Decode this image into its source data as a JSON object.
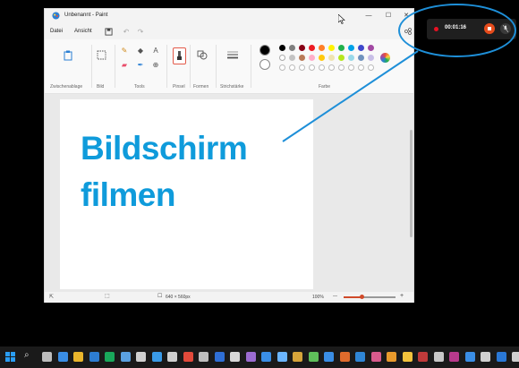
{
  "window": {
    "title": "Unbenannt - Paint",
    "controls": {
      "minimize": "—",
      "maximize": "☐",
      "close": "✕"
    }
  },
  "menu": {
    "file": "Datei",
    "view": "Ansicht"
  },
  "ribbon": {
    "groups": {
      "clipboard": "Zwischenablage",
      "image": "Bild",
      "tools": "Tools",
      "brushes": "Pinsel",
      "shapes": "Formen",
      "size": "Strichstärke",
      "colors": "Farbe"
    },
    "palette_row1": [
      "#000000",
      "#7f7f7f",
      "#880015",
      "#ed1c24",
      "#ff7f27",
      "#fff200",
      "#22b14c",
      "#00a2e8",
      "#3f48cc",
      "#a349a4"
    ],
    "palette_row2": [
      "#ffffff",
      "#c3c3c3",
      "#b97a57",
      "#ffaec9",
      "#ffc90e",
      "#efe4b0",
      "#b5e61d",
      "#99d9ea",
      "#7092be",
      "#c8bfe7"
    ],
    "primary_color": "#000000",
    "secondary_color": "#ffffff"
  },
  "canvas": {
    "line1": "Bildschirm",
    "line2": "filmen",
    "text_color": "#0f9bdb"
  },
  "status": {
    "dimensions": "640 × 560px",
    "zoom": "100%",
    "zoom_out": "—",
    "zoom_in": "+"
  },
  "recorder": {
    "time": "00:01:16",
    "stop_color": "#e74c1c",
    "dot_color": "#e81123"
  },
  "annotation": {
    "color": "#1e8fd8"
  }
}
